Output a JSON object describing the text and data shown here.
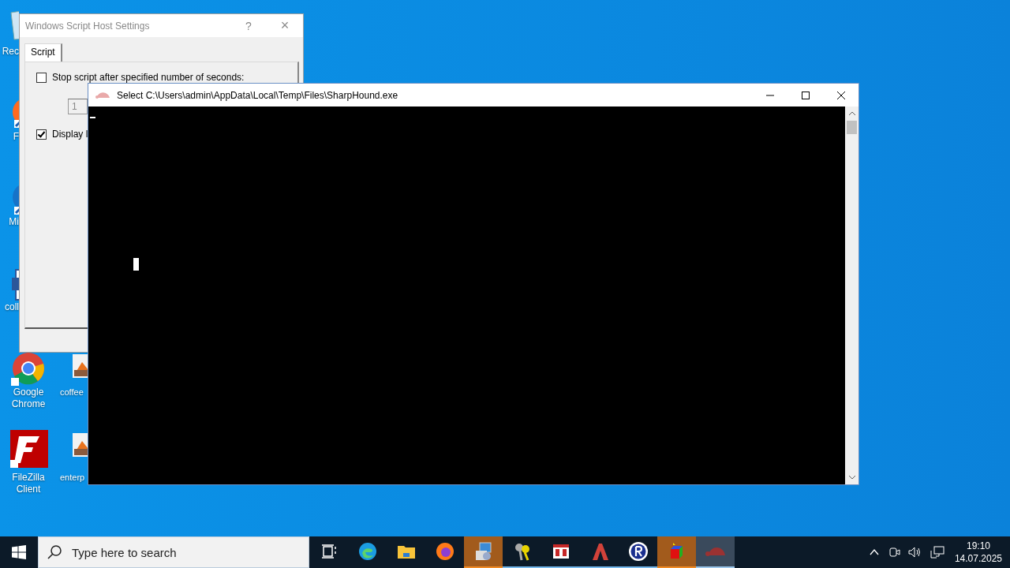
{
  "desktop_icons": [
    {
      "label": "Rec",
      "kind": "bin"
    },
    {
      "label": "F",
      "kind": "orange-app"
    },
    {
      "label": "Mi",
      "kind": "blue-app"
    },
    {
      "label": "coll",
      "kind": "document"
    },
    {
      "label": "Google Chrome",
      "kind": "chrome"
    },
    {
      "label": "FileZilla Client",
      "kind": "filezilla"
    },
    {
      "label": "coffee",
      "kind": "image"
    },
    {
      "label": "enterp",
      "kind": "image"
    }
  ],
  "dialog": {
    "title": "Windows Script Host Settings",
    "help": "?",
    "close": "×",
    "tabs": [
      {
        "label": "Script",
        "selected": true
      }
    ],
    "options": [
      {
        "label": "Stop script after specified number of seconds:",
        "checked": false
      },
      {
        "label": "Display l",
        "checked": true
      }
    ],
    "seconds_field": {
      "value": "1"
    }
  },
  "console": {
    "title": "Select C:\\Users\\admin\\AppData\\Local\\Temp\\Files\\SharpHound.exe"
  },
  "taskbar": {
    "search": {
      "placeholder": "Type here to search"
    },
    "apps": [
      {
        "kind": "task-view",
        "running": false,
        "flashing": false,
        "selected": false
      },
      {
        "kind": "edge",
        "running": false,
        "flashing": false,
        "selected": false
      },
      {
        "kind": "folder",
        "running": false,
        "flashing": false,
        "selected": false
      },
      {
        "kind": "firefox",
        "running": false,
        "flashing": false,
        "selected": false
      },
      {
        "kind": "installer",
        "running": true,
        "flashing": true,
        "selected": false
      },
      {
        "kind": "keys",
        "running": true,
        "flashing": false,
        "selected": false
      },
      {
        "kind": "calendar",
        "running": true,
        "flashing": false,
        "selected": false
      },
      {
        "kind": "red-a",
        "running": true,
        "flashing": false,
        "selected": false
      },
      {
        "kind": "r-circle",
        "running": true,
        "flashing": false,
        "selected": false
      },
      {
        "kind": "cube",
        "running": true,
        "flashing": true,
        "selected": false
      },
      {
        "kind": "turtle",
        "running": true,
        "flashing": false,
        "selected": true
      }
    ],
    "time": "19:10",
    "date": "14.07.2025"
  }
}
